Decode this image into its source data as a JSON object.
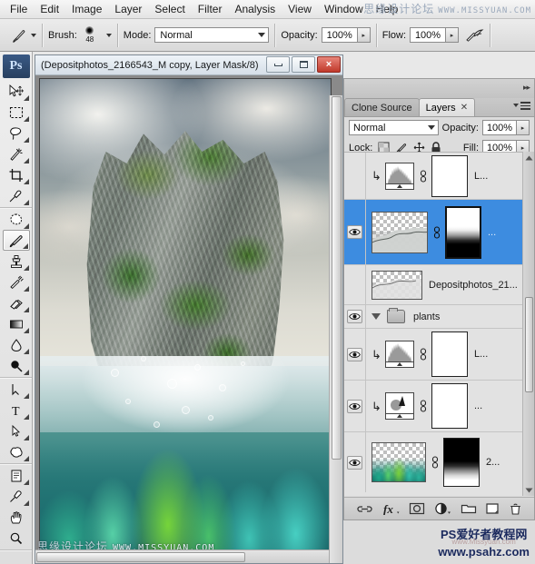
{
  "app": {
    "name": "Adobe Photoshop",
    "logo_text": "Ps"
  },
  "menubar": {
    "items": [
      {
        "label": "File"
      },
      {
        "label": "Edit"
      },
      {
        "label": "Image"
      },
      {
        "label": "Layer"
      },
      {
        "label": "Select"
      },
      {
        "label": "Filter"
      },
      {
        "label": "Analysis"
      },
      {
        "label": "View"
      },
      {
        "label": "Window"
      },
      {
        "label": "Help"
      }
    ]
  },
  "watermarks": {
    "top_cn": "思缘设计论坛",
    "top_en": "WWW.MISSYUAN.COM",
    "bottom_left_cn": "思缘设计论坛",
    "bottom_left_en": "WWW.MISSYUAN.COM",
    "bottom_right_cn": "PS爱好者教程网",
    "bottom_right_en": "www.psahz.com",
    "bottom_right_ghost": "www.Missyuan.com"
  },
  "options_bar": {
    "tool_preset_icon": "brush-icon",
    "brush_label": "Brush:",
    "brush_size": "48",
    "mode_label": "Mode:",
    "mode_value": "Normal",
    "opacity_label": "Opacity:",
    "opacity_value": "100%",
    "flow_label": "Flow:",
    "flow_value": "100%",
    "airbrush_icon": "airbrush-icon"
  },
  "toolbox": {
    "tools": [
      {
        "name": "move-tool",
        "selected": false
      },
      {
        "name": "rectangular-marquee-tool",
        "selected": false
      },
      {
        "name": "lasso-tool",
        "selected": false
      },
      {
        "name": "magic-wand-tool",
        "selected": false
      },
      {
        "name": "crop-tool",
        "selected": false
      },
      {
        "name": "eyedropper-tool",
        "selected": false
      },
      {
        "name": "healing-brush-tool",
        "selected": false
      },
      {
        "name": "brush-tool",
        "selected": true
      },
      {
        "name": "clone-stamp-tool",
        "selected": false
      },
      {
        "name": "history-brush-tool",
        "selected": false
      },
      {
        "name": "eraser-tool",
        "selected": false
      },
      {
        "name": "gradient-tool",
        "selected": false
      },
      {
        "name": "blur-tool",
        "selected": false
      },
      {
        "name": "dodge-tool",
        "selected": false
      },
      {
        "name": "pen-tool",
        "selected": false
      },
      {
        "name": "horizontal-type-tool",
        "selected": false
      },
      {
        "name": "path-selection-tool",
        "selected": false
      },
      {
        "name": "custom-shape-tool",
        "selected": false
      },
      {
        "name": "notes-tool",
        "selected": false
      },
      {
        "name": "color-sampler-tool",
        "selected": false
      },
      {
        "name": "hand-tool",
        "selected": false
      },
      {
        "name": "zoom-tool",
        "selected": false
      }
    ]
  },
  "document": {
    "title": "(Depositphotos_2166543_M copy, Layer Mask/8)",
    "window_buttons": {
      "minimize": "minimize",
      "restore": "restore",
      "close": "×"
    }
  },
  "layers_panel": {
    "tabs": [
      {
        "label": "Clone Source",
        "active": false,
        "closable": false
      },
      {
        "label": "Layers",
        "active": true,
        "closable": true
      }
    ],
    "blend_mode": "Normal",
    "opacity_label": "Opacity:",
    "opacity_value": "100%",
    "lock_label": "Lock:",
    "lock_icons": [
      "lock-transparency-icon",
      "lock-image-icon",
      "lock-position-icon",
      "lock-all-icon"
    ],
    "fill_label": "Fill:",
    "fill_value": "100%",
    "rows": [
      {
        "kind": "adjustment",
        "adj_type": "levels",
        "visible": false,
        "selected": false,
        "clipped": true,
        "has_mask": true,
        "linked": true,
        "name": "L..."
      },
      {
        "kind": "pixel",
        "thumb": "transparent-rocks",
        "visible": true,
        "selected": true,
        "clipped": false,
        "has_mask": true,
        "mask_style": "gradient-white-to-black",
        "linked": true,
        "name": "..."
      },
      {
        "kind": "pixel",
        "thumb": "transparent-rocks",
        "visible": false,
        "selected": false,
        "clipped": false,
        "has_mask": false,
        "linked": false,
        "name": "Depositphotos_21..."
      },
      {
        "kind": "group",
        "visible": true,
        "selected": false,
        "expanded": true,
        "name": "plants"
      },
      {
        "kind": "adjustment",
        "adj_type": "levels",
        "visible": true,
        "selected": false,
        "clipped": true,
        "has_mask": true,
        "linked": true,
        "name": "L..."
      },
      {
        "kind": "adjustment",
        "adj_type": "curves",
        "visible": true,
        "selected": false,
        "clipped": true,
        "has_mask": true,
        "linked": true,
        "name": "..."
      },
      {
        "kind": "pixel",
        "thumb": "coral",
        "visible": true,
        "selected": false,
        "clipped": false,
        "has_mask": true,
        "mask_style": "gradient-black-to-white",
        "linked": true,
        "name": "2..."
      }
    ],
    "footer_buttons": [
      {
        "name": "link-layers-button",
        "icon": "link-icon"
      },
      {
        "name": "layer-style-button",
        "icon": "fx-icon",
        "label": "fx"
      },
      {
        "name": "add-layer-mask-button",
        "icon": "mask-icon"
      },
      {
        "name": "new-adjustment-layer-button",
        "icon": "half-circle-icon"
      },
      {
        "name": "new-group-button",
        "icon": "folder-icon"
      },
      {
        "name": "new-layer-button",
        "icon": "new-layer-icon"
      },
      {
        "name": "delete-layer-button",
        "icon": "trash-icon"
      }
    ]
  },
  "colors": {
    "selection_blue": "#3d8ce0",
    "panel_gray": "#dcdcdc",
    "chrome_gray": "#e8e8e8",
    "close_red": "#c0392b"
  }
}
